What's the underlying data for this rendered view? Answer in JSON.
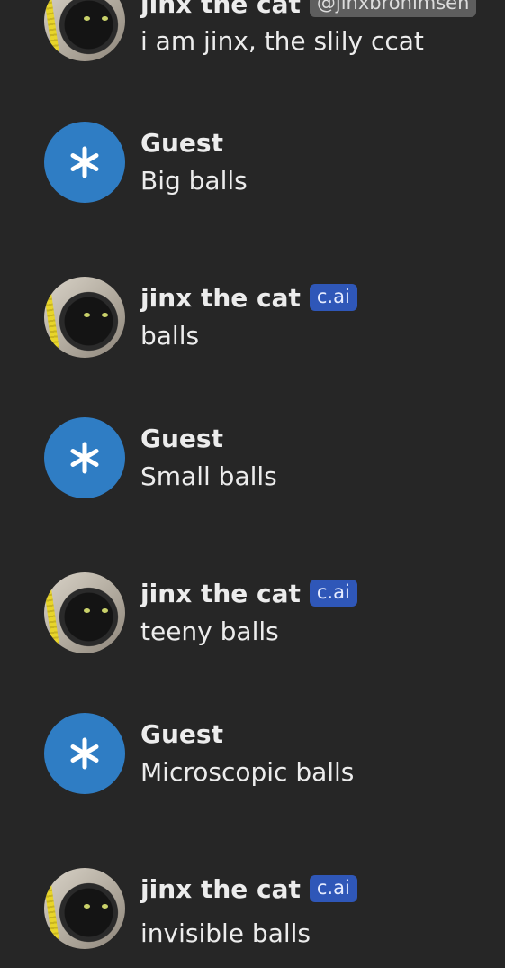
{
  "messages": [
    {
      "author": "jinx the cat",
      "badge": "@jinxbronimsen",
      "text": "i am jinx, the slily ccat",
      "avatar_icon": "cat-photo-avatar"
    },
    {
      "author": "Guest",
      "text": "Big balls",
      "avatar_icon": "asterisk-icon"
    },
    {
      "author": "jinx the cat",
      "badge": "c.ai",
      "text": "balls",
      "avatar_icon": "cat-photo-avatar"
    },
    {
      "author": "Guest",
      "text": "Small balls",
      "avatar_icon": "asterisk-icon"
    },
    {
      "author": "jinx the cat",
      "badge": "c.ai",
      "text": "teeny balls",
      "avatar_icon": "cat-photo-avatar"
    },
    {
      "author": "Guest",
      "text": "Microscopic balls",
      "avatar_icon": "asterisk-icon"
    },
    {
      "author": "jinx the cat",
      "badge": "c.ai",
      "text": "invisible balls",
      "avatar_icon": "cat-photo-avatar"
    }
  ],
  "colors": {
    "background": "#262626",
    "guest_avatar": "#2f7dc4",
    "cai_badge": "#2f57b8",
    "handle_badge": "#5e5e5e",
    "text": "#ececec"
  }
}
